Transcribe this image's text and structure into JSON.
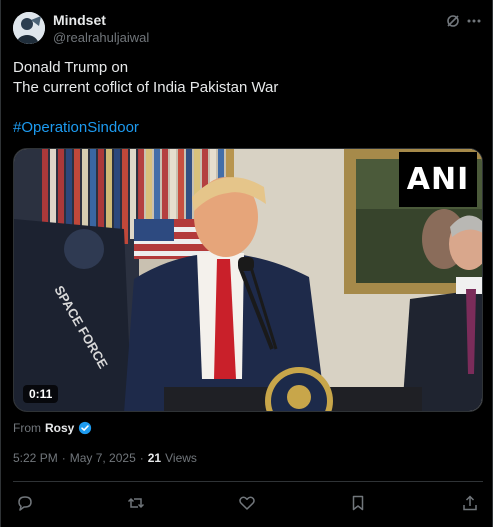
{
  "author": {
    "display_name": "Mindset",
    "handle": "@realrahuljaiwal"
  },
  "post": {
    "text": "Donald Trump on\nThe current coflict of India Pakistan War",
    "hashtag": "#OperationSindoor"
  },
  "media": {
    "duration": "0:11",
    "watermark": "ANI",
    "flag_text": "SPACE FORCE"
  },
  "attribution": {
    "from_label": "From",
    "from_name": "Rosy"
  },
  "meta": {
    "time": "5:22 PM",
    "separator": "·",
    "date": "May 7, 2025",
    "separator2": "·",
    "views_count": "21",
    "views_label": "Views"
  },
  "actions": [
    "reply-icon",
    "repost-icon",
    "like-icon",
    "bookmark-icon",
    "share-icon"
  ],
  "colors": {
    "background": "#000000",
    "text": "#e7e9ea",
    "secondary": "#71767b",
    "link": "#1d9bf0",
    "divider": "#2f3336"
  }
}
